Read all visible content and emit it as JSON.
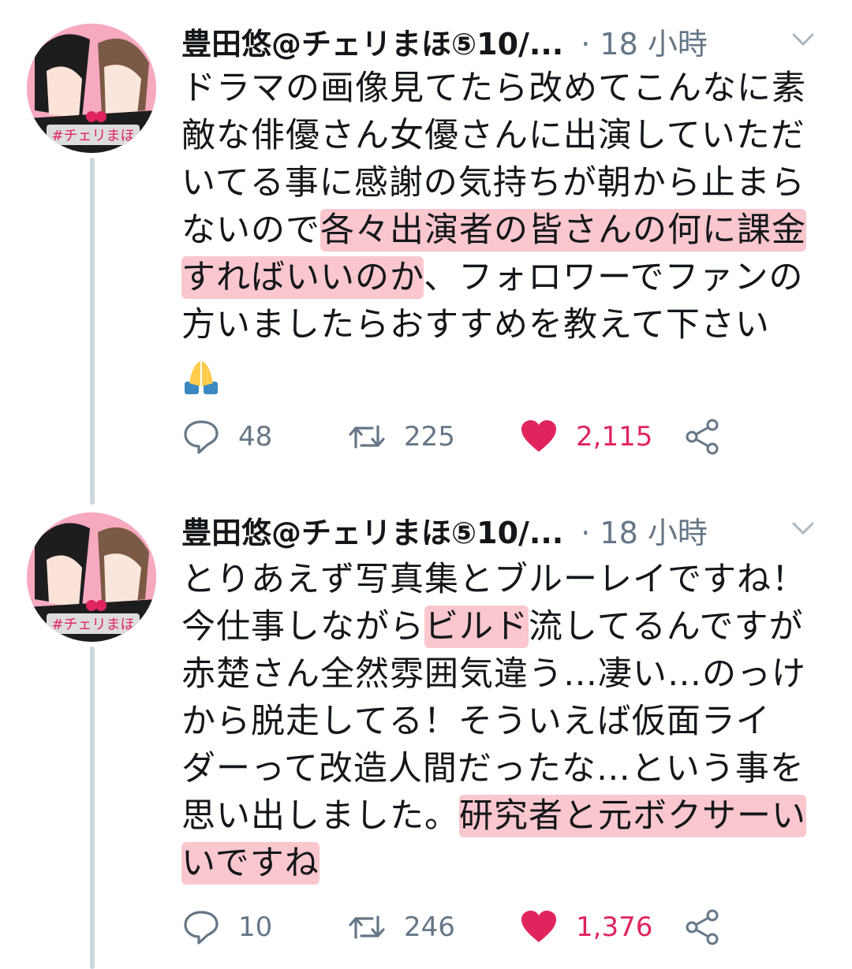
{
  "tweets": [
    {
      "author": "豊田悠@チェリまほ⑤10/...",
      "time": "· 18 小時",
      "avatar_text": "#チェリまほ",
      "lines": [
        [
          {
            "t": "ドラマの画像見てたら改めてこんなに素",
            "hl": false
          }
        ],
        [
          {
            "t": "敵な俳優さん女優さんに出演していただ",
            "hl": false
          }
        ],
        [
          {
            "t": "いてる事に感謝の気持ちが朝から止まら",
            "hl": false
          }
        ],
        [
          {
            "t": "ないので",
            "hl": false
          },
          {
            "t": "各々出演者の皆さんの何に課金",
            "hl": true
          }
        ],
        [
          {
            "t": "すればいいのか",
            "hl": true
          },
          {
            "t": "、フォロワーでファンの",
            "hl": false
          }
        ],
        [
          {
            "t": "方いましたらおすすめを教えて下さい",
            "hl": false
          }
        ]
      ],
      "emoji": "🙏",
      "stats": {
        "replies": "48",
        "retweets": "225",
        "likes": "2,115"
      }
    },
    {
      "author": "豊田悠@チェリまほ⑤10/...",
      "time": "· 18 小時",
      "avatar_text": "#チェリまほ",
      "lines": [
        [
          {
            "t": "とりあえず写真集とブルーレイですね！",
            "hl": false
          }
        ],
        [
          {
            "t": "今仕事しながら",
            "hl": false
          },
          {
            "t": "ビルド",
            "hl": true
          },
          {
            "t": "流してるんですが",
            "hl": false
          }
        ],
        [
          {
            "t": "赤楚さん全然雰囲気違う…凄い…のっけ",
            "hl": false
          }
        ],
        [
          {
            "t": "から脱走してる！そういえば仮面ライ",
            "hl": false
          }
        ],
        [
          {
            "t": "ダーって改造人間だったな…という事を",
            "hl": false
          }
        ],
        [
          {
            "t": "思い出しました。",
            "hl": false
          },
          {
            "t": "研究者と元ボクサーい",
            "hl": true
          }
        ],
        [
          {
            "t": "いですね",
            "hl": true
          }
        ]
      ],
      "emoji": "",
      "stats": {
        "replies": "10",
        "retweets": "246",
        "likes": "1,376"
      }
    }
  ],
  "icons": {
    "reply": "reply-icon",
    "retweet": "retweet-icon",
    "like": "heart-icon",
    "share": "share-icon",
    "menu": "chevron-down-icon"
  },
  "colors": {
    "like": "#e0245e",
    "muted": "#657786",
    "text": "#14171a",
    "highlight": "#f8b4be",
    "thread_line": "#ccd6dd"
  }
}
